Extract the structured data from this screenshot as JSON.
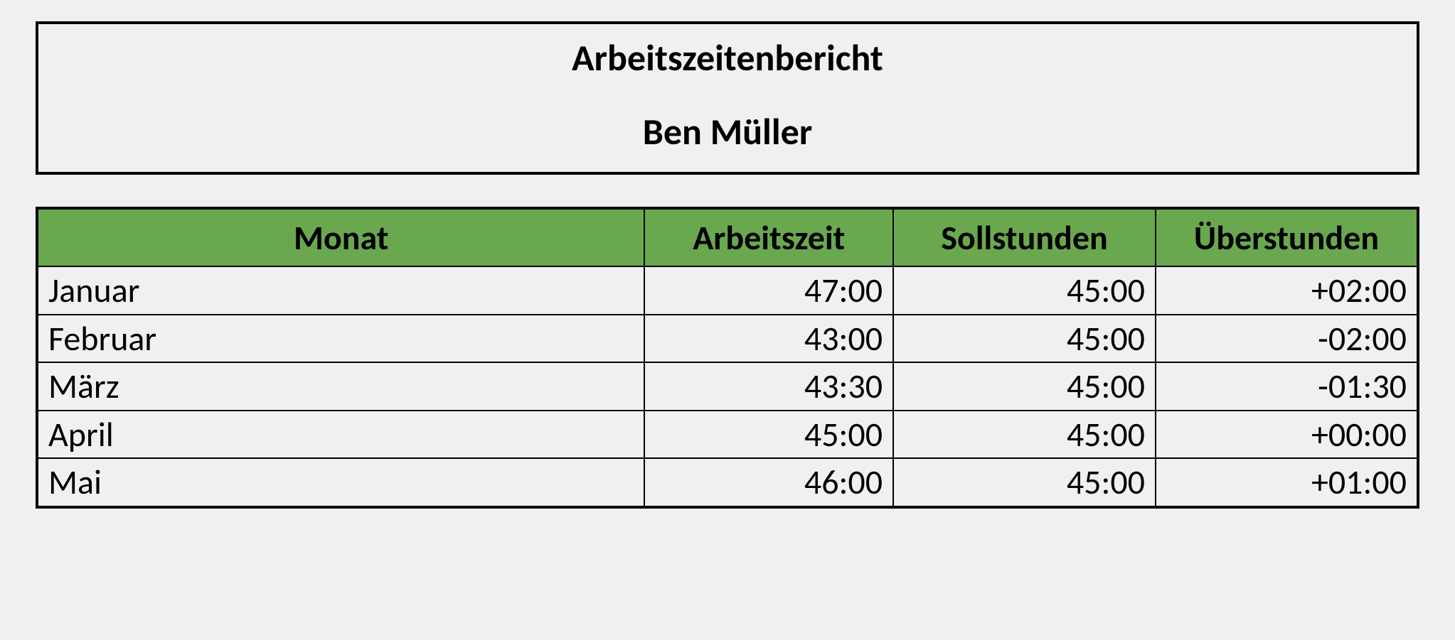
{
  "header": {
    "title": "Arbeitszeitenbericht",
    "person": "Ben Müller"
  },
  "table": {
    "columns": {
      "month": "Monat",
      "work": "Arbeitszeit",
      "target": "Sollstunden",
      "overtime": "Überstunden"
    },
    "rows": [
      {
        "month": "Januar",
        "work": "47:00",
        "target": "45:00",
        "overtime": "+02:00"
      },
      {
        "month": "Februar",
        "work": "43:00",
        "target": "45:00",
        "overtime": "-02:00"
      },
      {
        "month": "März",
        "work": "43:30",
        "target": "45:00",
        "overtime": "-01:30"
      },
      {
        "month": "April",
        "work": "45:00",
        "target": "45:00",
        "overtime": "+00:00"
      },
      {
        "month": "Mai",
        "work": "46:00",
        "target": "45:00",
        "overtime": "+01:00"
      }
    ]
  }
}
